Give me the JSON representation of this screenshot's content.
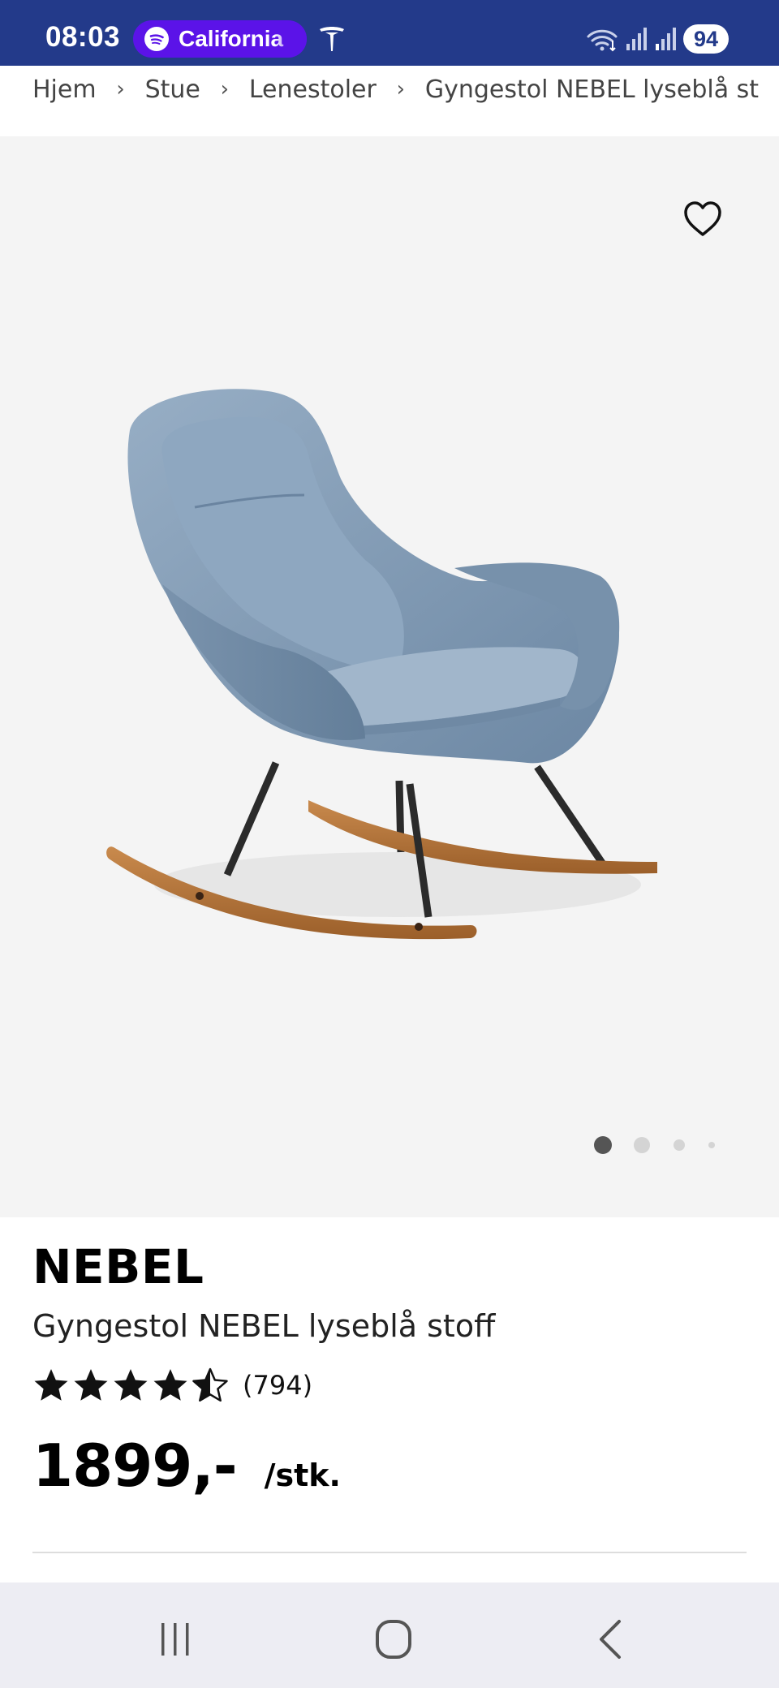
{
  "status_bar": {
    "time": "08:03",
    "spotify_label": "California",
    "battery": "94",
    "icons": [
      "spotify-icon",
      "tesla-icon",
      "wifi-5g-icon",
      "signal-icon",
      "signal-icon"
    ]
  },
  "breadcrumb": {
    "items": [
      "Hjem",
      "Stue",
      "Lenestoler",
      "Gyngestol NEBEL lyseblå st"
    ],
    "separator": "›"
  },
  "gallery": {
    "favorite_icon": "heart-outline-icon",
    "image_count": 4,
    "active_index": 0
  },
  "product": {
    "brand": "NEBEL",
    "name": "Gyngestol NEBEL lyseblå stoff",
    "rating": 4.5,
    "rating_max": 5,
    "review_count": "(794)",
    "price": "1899,-",
    "unit": "/stk."
  },
  "nav": {
    "buttons": [
      "recent-apps-icon",
      "home-icon",
      "back-icon"
    ]
  },
  "colors": {
    "status_bar": "#233a8a",
    "spotify_pill": "#5b13e8",
    "gallery_bg": "#f4f4f4",
    "nav_bar": "#ededf3"
  }
}
